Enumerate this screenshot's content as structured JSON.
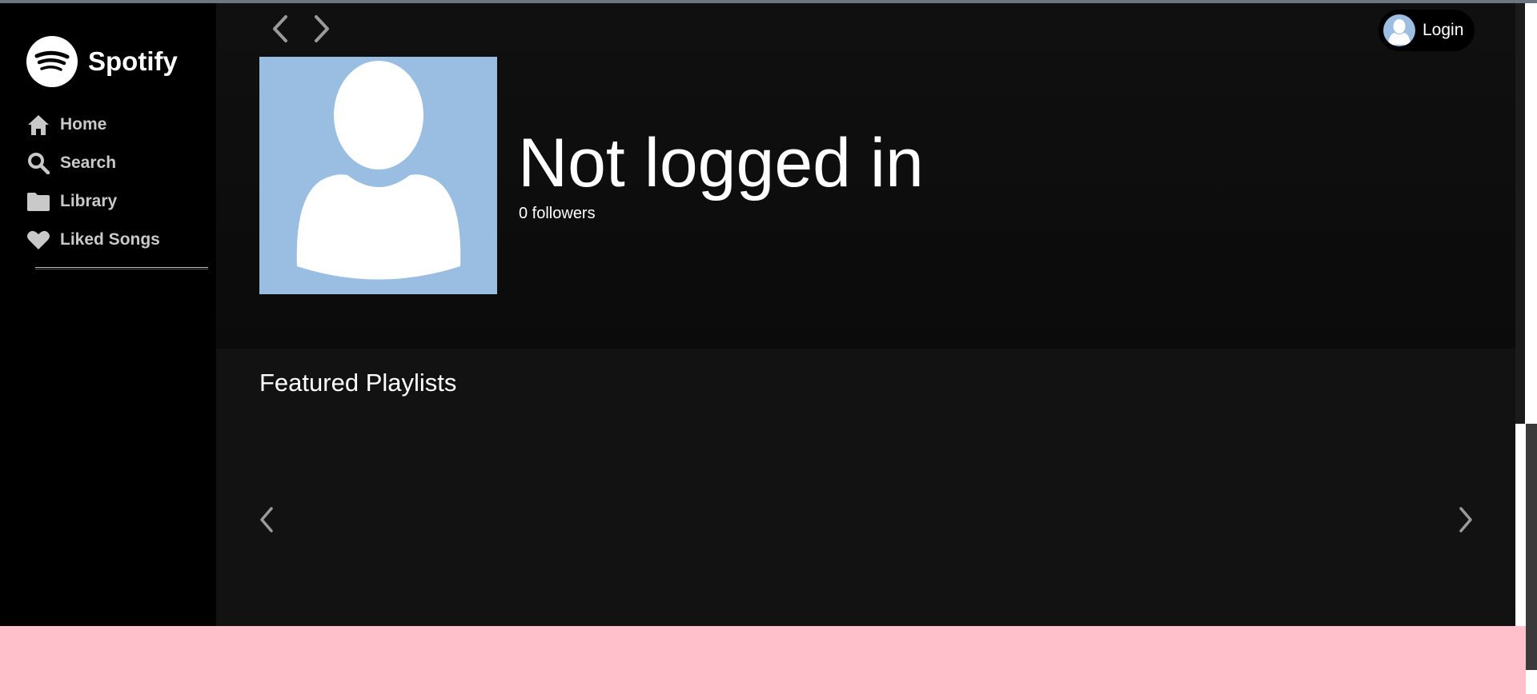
{
  "brand": {
    "name": "Spotify",
    "logo_icon": "spotify-logo-icon"
  },
  "sidebar": {
    "items": [
      {
        "label": "Home",
        "icon": "home-icon"
      },
      {
        "label": "Search",
        "icon": "search-icon"
      },
      {
        "label": "Library",
        "icon": "folder-icon"
      },
      {
        "label": "Liked Songs",
        "icon": "heart-icon"
      }
    ]
  },
  "header": {
    "back_icon": "chevron-left-icon",
    "forward_icon": "chevron-right-icon",
    "login_label": "Login",
    "login_avatar_icon": "user-avatar-icon"
  },
  "profile": {
    "name": "Not logged in",
    "followers": "0 followers",
    "image_icon": "default-user-icon"
  },
  "featured": {
    "title": "Featured Playlists",
    "prev_icon": "chevron-left-icon",
    "next_icon": "chevron-right-icon",
    "items": []
  },
  "colors": {
    "sidebar_bg": "#000000",
    "main_bg": "#121212",
    "hero_bg": "#0e0e0e",
    "avatar_bg": "#9abee2",
    "player_bar_bg": "#ffc0cb",
    "nav_text": "#c9c9c9"
  }
}
